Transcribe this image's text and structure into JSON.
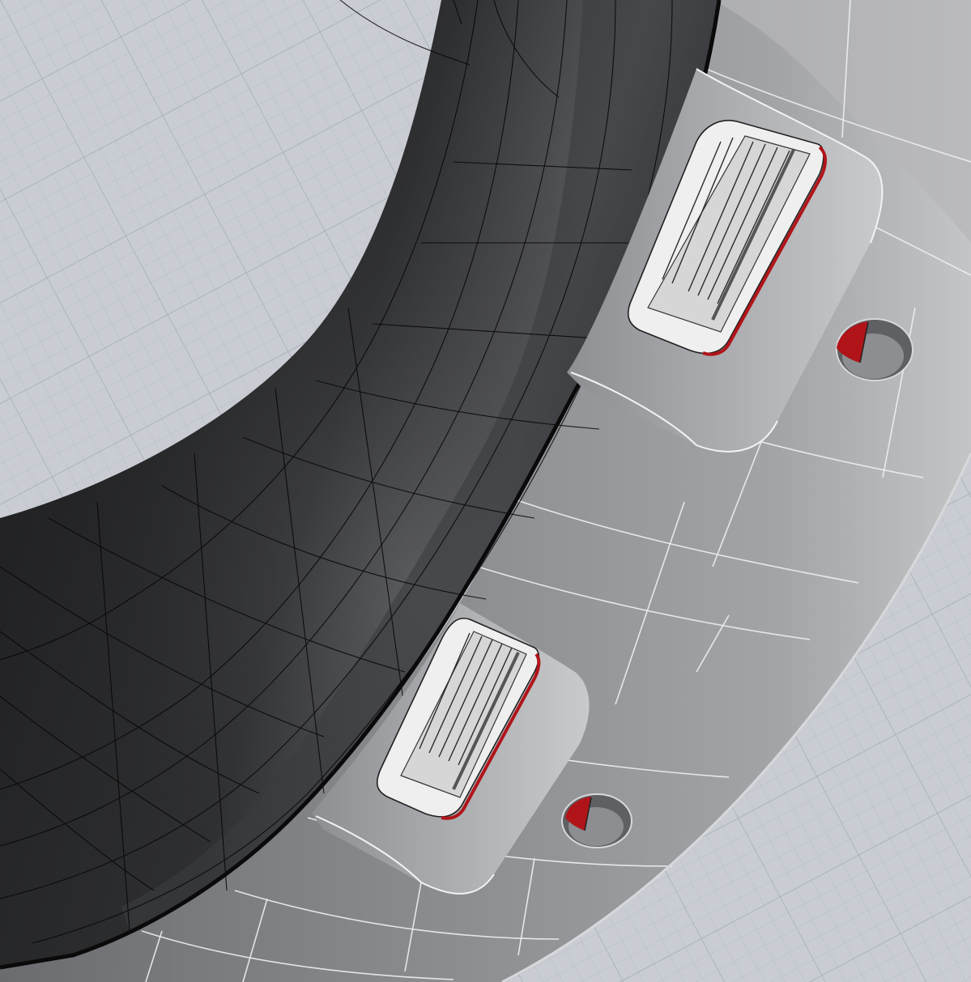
{
  "viewport": {
    "background": "#c9cdd3",
    "grid_minor_color": "#b9bec5",
    "grid_major_color": "#a9aeb6",
    "wireframe_line_color": "#000000",
    "band_edge_color": "#f4f5f6"
  },
  "model": {
    "inner_tire": {
      "colors": [
        "#1a1a1b",
        "#4e4f52",
        "#2a2a2c"
      ]
    },
    "outer_band": {
      "colors": [
        "#6d6f73",
        "#9a9c9f",
        "#c6c7c9"
      ]
    },
    "ports": [
      {
        "icon": "hdmi-port-icon",
        "accent": "#b01419"
      },
      {
        "icon": "hdmi-port-icon",
        "accent": "#b01419"
      }
    ],
    "mount_holes": [
      {
        "icon": "screw-hole-icon",
        "accent": "#b01419"
      },
      {
        "icon": "screw-hole-icon",
        "accent": "#b01419"
      }
    ]
  }
}
